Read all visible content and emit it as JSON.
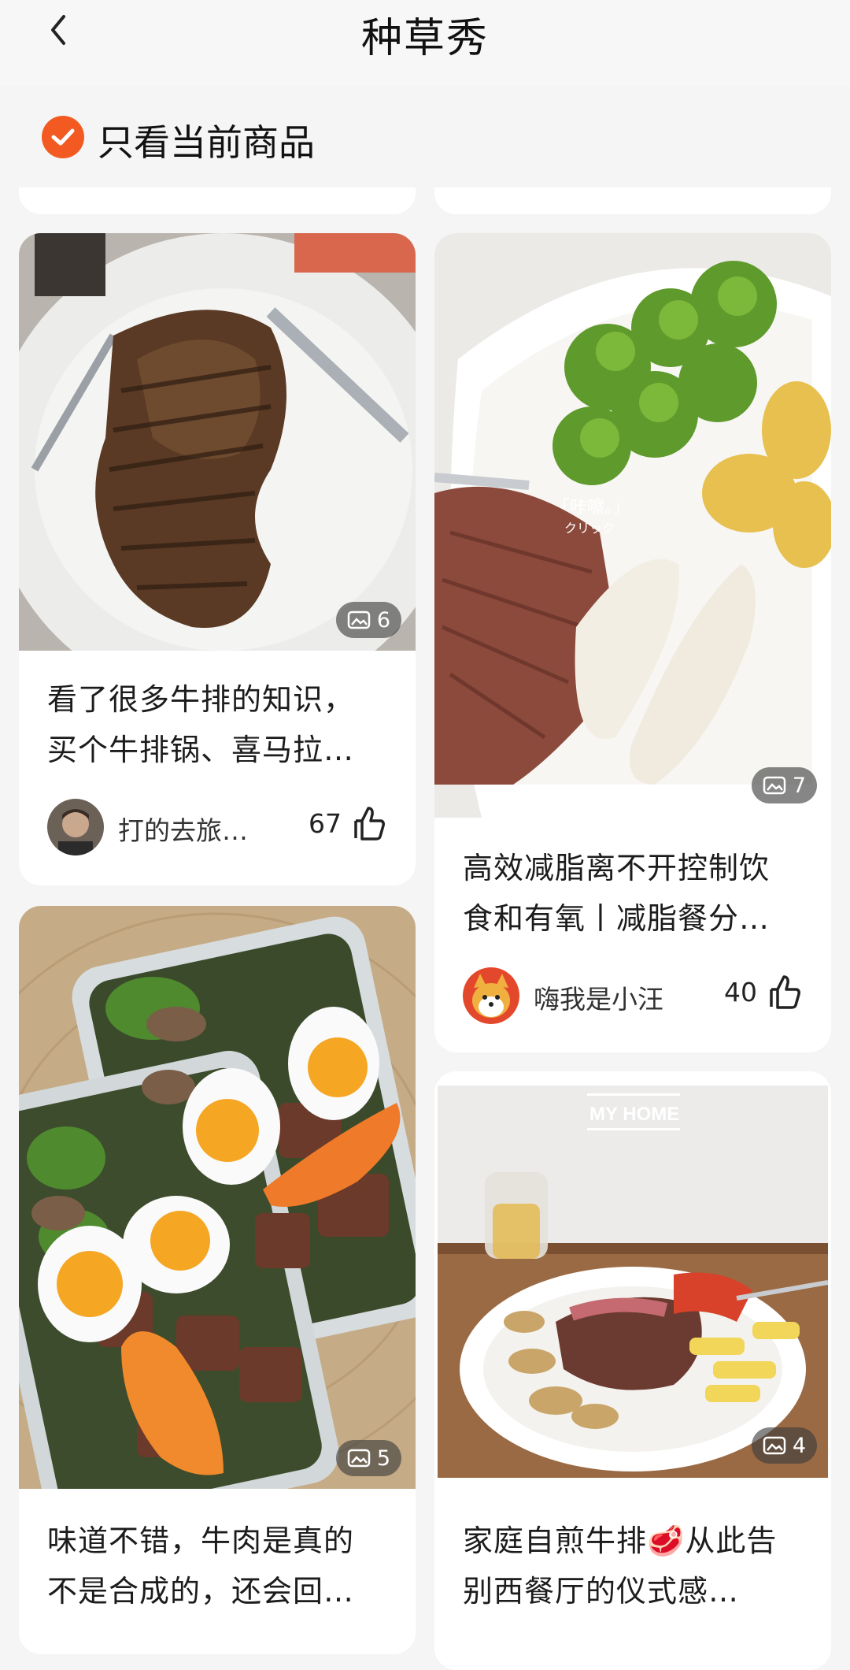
{
  "header": {
    "title": "种草秀"
  },
  "filter": {
    "label": "只看当前商品",
    "checked": true,
    "accent": "#f25a22"
  },
  "posts": [
    {
      "image_count": "6",
      "line1": "看了很多牛排的知识，",
      "line2": "买个牛排锅、喜马拉…",
      "author": "打的去旅…",
      "likes": "67",
      "image_icon": "photo-icon"
    },
    {
      "image_count": "7",
      "line1": "高效减脂离不开控制饮",
      "line2": "食和有氧丨减脂餐分…",
      "author": "嗨我是小汪",
      "likes": "40",
      "image_icon": "photo-icon"
    },
    {
      "image_count": "5",
      "line1": "味道不错，牛肉是真的",
      "line2": "不是合成的，还会回…"
    },
    {
      "image_count": "4",
      "photo_caption": "MY HOME",
      "line1": "家庭自煎牛排🥩从此告",
      "line2": "别西餐厅的仪式感…"
    }
  ],
  "photo2_overlay": {
    "main": "「咔嚓。」",
    "sub": "クリック"
  },
  "icons": {
    "back": "chevron-left-icon",
    "check": "check-circle-icon",
    "like": "thumbs-up-icon"
  }
}
